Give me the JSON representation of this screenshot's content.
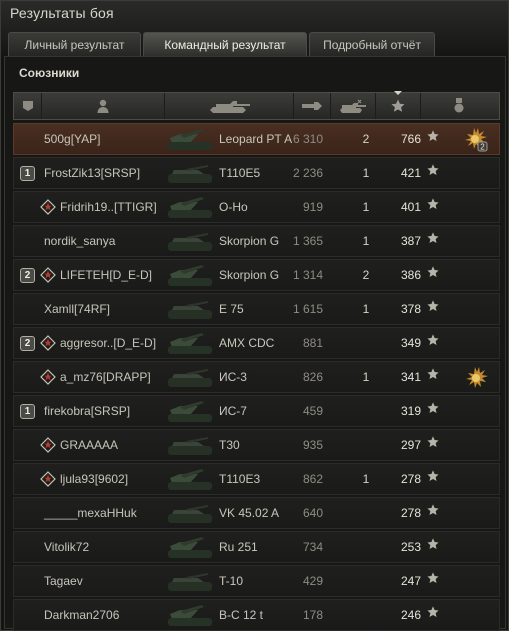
{
  "window": {
    "title": "Результаты боя"
  },
  "tabs": [
    {
      "label": "Личный результат",
      "active": false
    },
    {
      "label": "Командный результат",
      "active": true
    },
    {
      "label": "Подробный отчёт",
      "active": false
    }
  ],
  "section": {
    "title": "Союзники"
  },
  "columns": {
    "squad_icon": "squad-column-icon",
    "player_icon": "player-column-icon",
    "tank_icon": "tank-column-icon",
    "damage_icon": "damage-column-icon",
    "kills_icon": "kills-column-icon",
    "xp_icon": "xp-star-column-icon",
    "medals_icon": "medal-column-icon",
    "sorted_by": "xp"
  },
  "colors": {
    "self_row": "#4a2e22",
    "accent_text": "#e6e4d8"
  },
  "players": [
    {
      "name": "500g[YAP]",
      "tank": "Leopard PT A",
      "damage": "6 310",
      "kills": "2",
      "xp": "766",
      "platoon": "",
      "squad_icon": false,
      "medal": "medal-2",
      "self": true
    },
    {
      "name": "FrostZik13[SRSP]",
      "tank": "T110E5",
      "damage": "2 236",
      "kills": "1",
      "xp": "421",
      "platoon": "1",
      "squad_icon": false,
      "medal": "",
      "self": false
    },
    {
      "name": "Fridrih19..[TTIGR]",
      "tank": "O-Ho",
      "damage": "919",
      "kills": "1",
      "xp": "401",
      "platoon": "",
      "squad_icon": true,
      "medal": "",
      "self": false
    },
    {
      "name": "nordik_sanya",
      "tank": "Skorpion G",
      "damage": "1 365",
      "kills": "1",
      "xp": "387",
      "platoon": "",
      "squad_icon": false,
      "medal": "",
      "self": false
    },
    {
      "name": "LIFETEH[D_E-D]",
      "tank": "Skorpion G",
      "damage": "1 314",
      "kills": "2",
      "xp": "386",
      "platoon": "2",
      "squad_icon": true,
      "medal": "",
      "self": false
    },
    {
      "name": "Xamll[74RF]",
      "tank": "E 75",
      "damage": "1 615",
      "kills": "1",
      "xp": "378",
      "platoon": "",
      "squad_icon": false,
      "medal": "",
      "self": false
    },
    {
      "name": "aggresor..[D_E-D]",
      "tank": "AMX CDC",
      "damage": "881",
      "kills": "",
      "xp": "349",
      "platoon": "2",
      "squad_icon": true,
      "medal": "",
      "self": false
    },
    {
      "name": "a_mz76[DRAPP]",
      "tank": "ИС-3",
      "damage": "826",
      "kills": "1",
      "xp": "341",
      "platoon": "",
      "squad_icon": true,
      "medal": "medal-1",
      "self": false
    },
    {
      "name": "firekobra[SRSP]",
      "tank": "ИС-7",
      "damage": "459",
      "kills": "",
      "xp": "319",
      "platoon": "1",
      "squad_icon": false,
      "medal": "",
      "self": false
    },
    {
      "name": "GRAAAAA",
      "tank": "T30",
      "damage": "935",
      "kills": "",
      "xp": "297",
      "platoon": "",
      "squad_icon": true,
      "medal": "",
      "self": false
    },
    {
      "name": "ljula93[9602]",
      "tank": "T110E3",
      "damage": "862",
      "kills": "1",
      "xp": "278",
      "platoon": "",
      "squad_icon": true,
      "medal": "",
      "self": false
    },
    {
      "name": "_____mexaHHuk",
      "tank": "VK 45.02 A",
      "damage": "640",
      "kills": "",
      "xp": "278",
      "platoon": "",
      "squad_icon": false,
      "medal": "",
      "self": false
    },
    {
      "name": "Vitolik72",
      "tank": "Ru 251",
      "damage": "734",
      "kills": "",
      "xp": "253",
      "platoon": "",
      "squad_icon": false,
      "medal": "",
      "self": false
    },
    {
      "name": "Tagaev",
      "tank": "T-10",
      "damage": "429",
      "kills": "",
      "xp": "247",
      "platoon": "",
      "squad_icon": false,
      "medal": "",
      "self": false
    },
    {
      "name": "Darkman2706",
      "tank": "B-C 12 t",
      "damage": "178",
      "kills": "",
      "xp": "246",
      "platoon": "",
      "squad_icon": false,
      "medal": "",
      "self": false
    }
  ]
}
